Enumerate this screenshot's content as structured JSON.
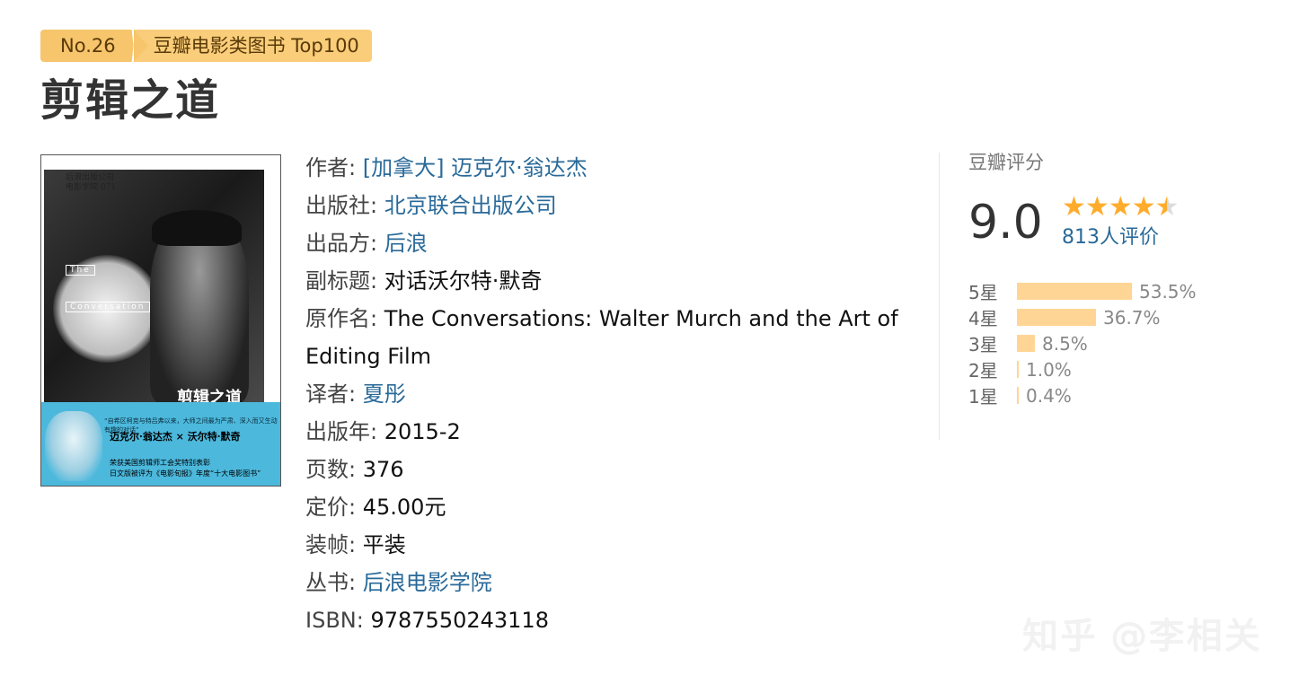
{
  "rank": {
    "number": "No.26",
    "list": "豆瓣电影类图书 Top100"
  },
  "title": "剪辑之道",
  "cover": {
    "publisher": "后浪出版公司",
    "series_no": "电影学院 071",
    "the": "The",
    "conversation": "Conversation",
    "title": "剪辑之道",
    "quote": "“自希区柯克与特吕弗以来，大师之间最为严肃、深入而又生动有趣的对话”",
    "names": "迈克尔·翁达杰 × 沃尔特·默奇",
    "line1": "荣获美国剪辑师工会奖特别表彰",
    "line2": "日文版被评为《电影旬报》年度“十大电影图书”"
  },
  "info": {
    "author_label": "作者:",
    "author": "[加拿大] 迈克尔·翁达杰",
    "publisher_label": "出版社:",
    "publisher": "北京联合出版公司",
    "producer_label": "出品方:",
    "producer": "后浪",
    "subtitle_label": "副标题:",
    "subtitle": "对话沃尔特·默奇",
    "original_label": "原作名:",
    "original": "The Conversations: Walter Murch and the Art of Editing Film",
    "translator_label": "译者:",
    "translator": "夏彤",
    "year_label": "出版年:",
    "year": "2015-2",
    "pages_label": "页数:",
    "pages": "376",
    "price_label": "定价:",
    "price": "45.00元",
    "binding_label": "装帧:",
    "binding": "平装",
    "series_label": "丛书:",
    "series": "后浪电影学院",
    "isbn_label": "ISBN:",
    "isbn": "9787550243118"
  },
  "rating": {
    "heading": "豆瓣评分",
    "score": "9.0",
    "stars": 4.5,
    "votes": "813人评价",
    "breakdown": [
      {
        "label": "5星",
        "percent": "53.5%",
        "value": 53.5
      },
      {
        "label": "4星",
        "percent": "36.7%",
        "value": 36.7
      },
      {
        "label": "3星",
        "percent": "8.5%",
        "value": 8.5
      },
      {
        "label": "2星",
        "percent": "1.0%",
        "value": 1.0
      },
      {
        "label": "1星",
        "percent": "0.4%",
        "value": 0.4
      }
    ]
  },
  "watermark": "知乎 @李相关",
  "colors": {
    "badge": "#f6c56c",
    "link": "#2a6a99",
    "star": "#ffac2d",
    "bar": "#ffd596"
  }
}
